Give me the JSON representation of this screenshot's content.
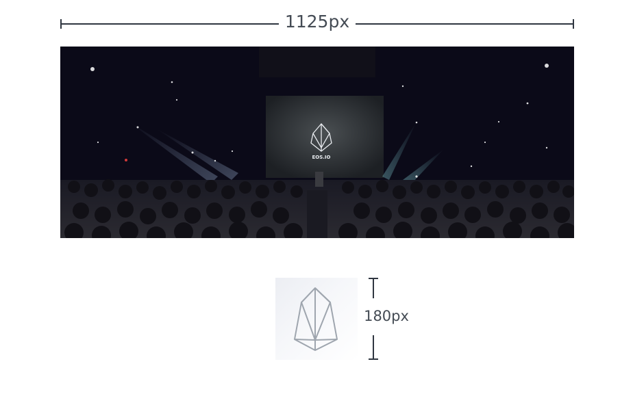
{
  "width_dimension": {
    "label": "1125px"
  },
  "height_dimension": {
    "label": "180px"
  },
  "banner": {
    "logo_text": "EOS.IO"
  },
  "colors": {
    "dimension_line": "#2f3640",
    "label_text": "#444b54",
    "banner_background": "#0b0a18"
  },
  "icons": {
    "avatar": "eos-logo-icon"
  }
}
